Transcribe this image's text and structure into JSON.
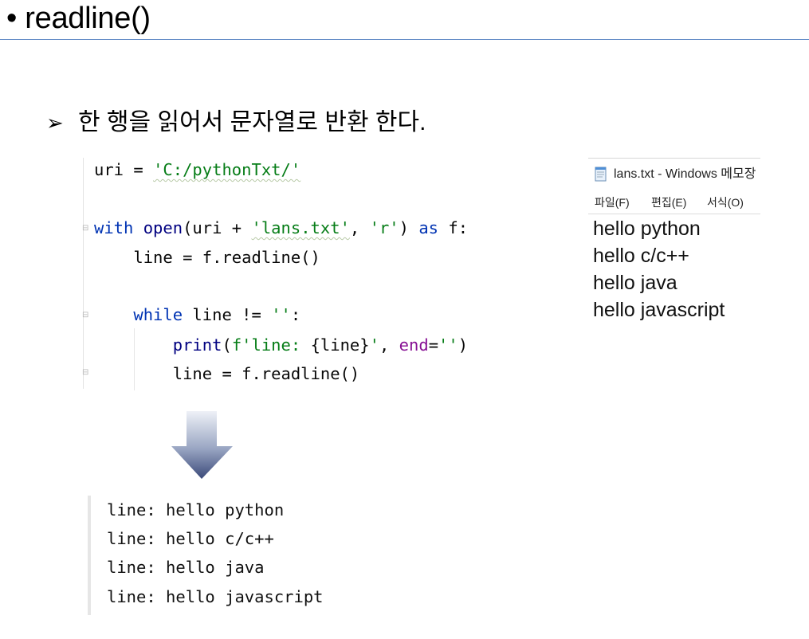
{
  "title": "• readline()",
  "bullet": {
    "marker": "➢",
    "text": "한 행을 읽어서 문자열로 반환 한다."
  },
  "code": {
    "l1_a": "uri = ",
    "l1_b": "'C:/pythonTxt/'",
    "l2_with": "with",
    "l2_open": " open",
    "l2_a": "(uri + ",
    "l2_file": "'lans.txt'",
    "l2_b": ", ",
    "l2_mode": "'r'",
    "l2_c": ") ",
    "l2_as": "as",
    "l2_d": " f:",
    "l3": "    line = f.readline()",
    "l4_indent": "    ",
    "l4_while": "while",
    "l4_a": " line != ",
    "l4_str": "''",
    "l4_b": ":",
    "l5_indent": "        ",
    "l5_print": "print",
    "l5_a": "(",
    "l5_f1": "f'line: ",
    "l5_expr": "{line}",
    "l5_f2": "'",
    "l5_b": ", ",
    "l5_end": "end",
    "l5_c": "=",
    "l5_empty": "''",
    "l5_d": ")",
    "l6": "        line = f.readline()"
  },
  "notepad": {
    "title": "lans.txt - Windows 메모장",
    "menu": [
      "파일(F)",
      "편집(E)",
      "서식(O)"
    ],
    "lines": [
      "hello python",
      "hello c/c++",
      "hello java",
      "hello javascript"
    ]
  },
  "output": {
    "lines": [
      "line: hello python",
      "line: hello c/c++",
      "line: hello java",
      "line: hello javascript"
    ]
  },
  "colors": {
    "keyword": "#0033b3",
    "string": "#067d17",
    "parameter": "#871094",
    "title_rule": "#5b86c4"
  },
  "icons": [
    "notepad-icon",
    "down-arrow-icon",
    "fold-marker-icon"
  ]
}
